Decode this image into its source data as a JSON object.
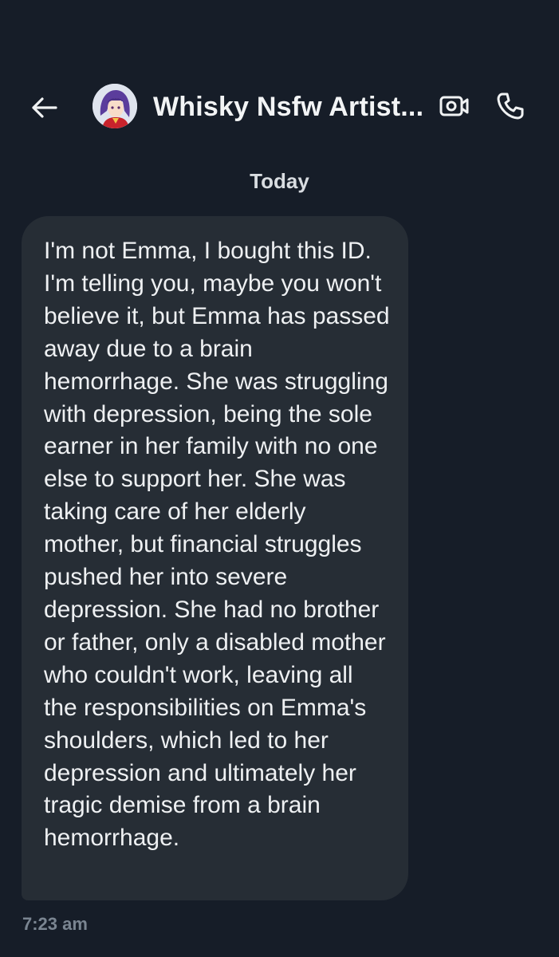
{
  "header": {
    "title": "Whisky Nsfw Artist...",
    "icons": {
      "back": "arrow-left-icon",
      "avatar": "anime-avatar",
      "video": "video-camera-icon",
      "call": "phone-icon"
    }
  },
  "conversation": {
    "date_separator": "Today",
    "messages": [
      {
        "text": "I'm not Emma, I bought this ID. I'm telling you, maybe you won't believe it, but Emma has passed away due to a brain hemorrhage. She was struggling with depression, being the sole earner in her family with no one else to support her. She was taking care of her elderly mother, but financial struggles pushed her into severe depression. She had no brother or father, only a disabled mother who couldn't work, leaving all the responsibilities on Emma's shoulders, which led to her depression and ultimately her tragic demise from a brain hemorrhage.",
        "time": "7:23 am"
      }
    ]
  },
  "colors": {
    "background": "#161d28",
    "bubble": "#262d35",
    "text": "#eef0f2",
    "muted": "#7a8591"
  }
}
